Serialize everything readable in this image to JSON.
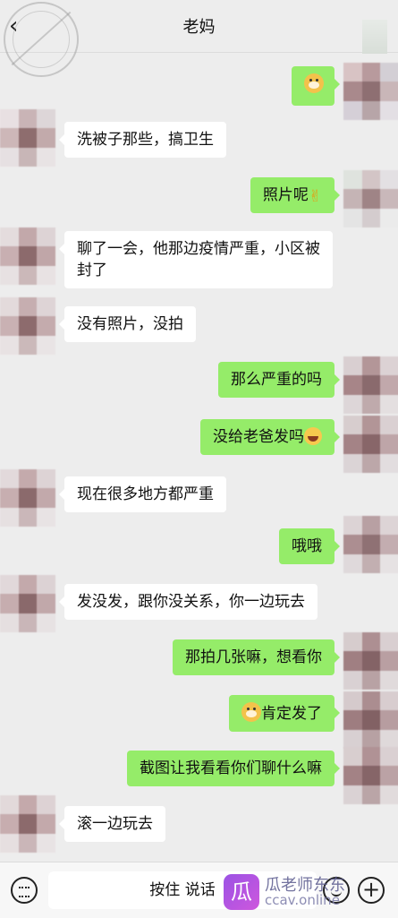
{
  "header": {
    "title": "老妈",
    "back_icon": "back-chevron-icon",
    "corner_watermark_text": "shenzhou"
  },
  "messages": [
    {
      "side": "out",
      "text": "",
      "emoji": "doge-emoji"
    },
    {
      "side": "in",
      "text": "洗被子那些，搞卫生"
    },
    {
      "side": "out",
      "text": "照片呢",
      "emoji": "victory-hand-emoji"
    },
    {
      "side": "in",
      "text": "聊了一会，他那边疫情严重，小区被封了"
    },
    {
      "side": "in",
      "text": "没有照片，没拍"
    },
    {
      "side": "out",
      "text": "那么严重的吗"
    },
    {
      "side": "out",
      "text": "没给老爸发吗",
      "emoji": "laughing-tears-emoji"
    },
    {
      "side": "in",
      "text": "现在很多地方都严重"
    },
    {
      "side": "out",
      "text": "哦哦"
    },
    {
      "side": "in",
      "text": "发没发，跟你没关系，你一边玩去"
    },
    {
      "side": "out",
      "text": "那拍几张嘛，想看你"
    },
    {
      "side": "out",
      "text": "肯定发了",
      "emoji": "doge-emoji"
    },
    {
      "side": "out",
      "text": "截图让我看看你们聊什么嘛"
    },
    {
      "side": "in",
      "text": "滚一边玩去"
    }
  ],
  "bottom_bar": {
    "hold_to_talk_label": "按住 说话",
    "keyboard_icon": "keyboard-icon",
    "emoji_icon": "emoji-face-icon",
    "plus_icon": "plus-icon"
  },
  "watermark": {
    "logo_char": "瓜",
    "line1": "瓜老师东东",
    "line2": "ccav.online"
  },
  "colors": {
    "background": "#ededed",
    "incoming_bubble": "#ffffff",
    "outgoing_bubble": "#95ec69"
  }
}
